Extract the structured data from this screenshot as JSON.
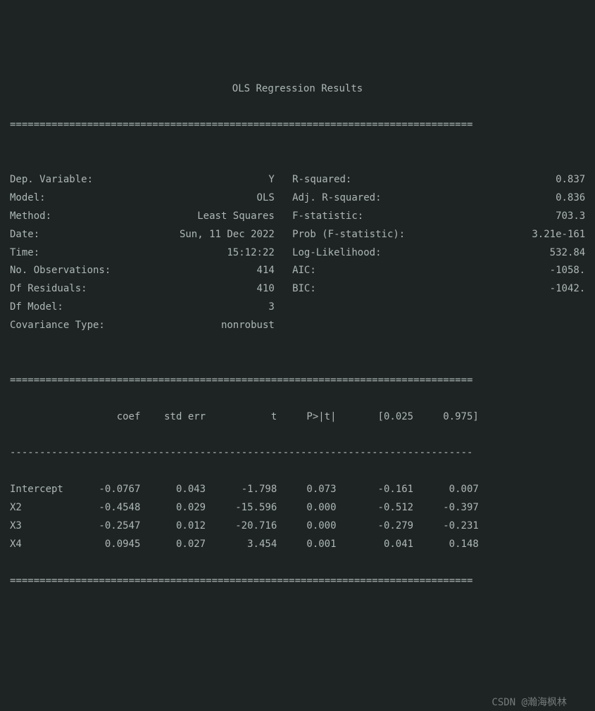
{
  "title": "OLS Regression Results",
  "rule": "==============================================================================",
  "dashes": "------------------------------------------------------------------------------",
  "left_stats": [
    {
      "label": "Dep. Variable:",
      "value": "Y"
    },
    {
      "label": "Model:",
      "value": "OLS"
    },
    {
      "label": "Method:",
      "value": "Least Squares"
    },
    {
      "label": "Date:",
      "value": "Sun, 11 Dec 2022"
    },
    {
      "label": "Time:",
      "value": "15:12:22"
    },
    {
      "label": "No. Observations:",
      "value": "414"
    },
    {
      "label": "Df Residuals:",
      "value": "410"
    },
    {
      "label": "Df Model:",
      "value": "3"
    },
    {
      "label": "Covariance Type:",
      "value": "nonrobust"
    }
  ],
  "right_stats": [
    {
      "label": "R-squared:",
      "value": "0.837"
    },
    {
      "label": "Adj. R-squared:",
      "value": "0.836"
    },
    {
      "label": "F-statistic:",
      "value": "703.3"
    },
    {
      "label": "Prob (F-statistic):",
      "value": "3.21e-161"
    },
    {
      "label": "Log-Likelihood:",
      "value": "532.84"
    },
    {
      "label": "AIC:",
      "value": "-1058."
    },
    {
      "label": "BIC:",
      "value": "-1042."
    }
  ],
  "coef_header": {
    "name": "",
    "coef": "coef",
    "se": "std err",
    "t": "t",
    "p": "P>|t|",
    "lo": "[0.025",
    "hi": "0.975]"
  },
  "coef_rows": [
    {
      "name": "Intercept",
      "coef": "-0.0767",
      "se": "0.043",
      "t": "-1.798",
      "p": "0.073",
      "lo": "-0.161",
      "hi": "0.007"
    },
    {
      "name": "X2",
      "coef": "-0.4548",
      "se": "0.029",
      "t": "-15.596",
      "p": "0.000",
      "lo": "-0.512",
      "hi": "-0.397"
    },
    {
      "name": "X3",
      "coef": "-0.2547",
      "se": "0.012",
      "t": "-20.716",
      "p": "0.000",
      "lo": "-0.279",
      "hi": "-0.231"
    },
    {
      "name": "X4",
      "coef": "0.0945",
      "se": "0.027",
      "t": "3.454",
      "p": "0.001",
      "lo": "0.041",
      "hi": "0.148"
    }
  ],
  "watermark": "CSDN @瀚海枫林"
}
